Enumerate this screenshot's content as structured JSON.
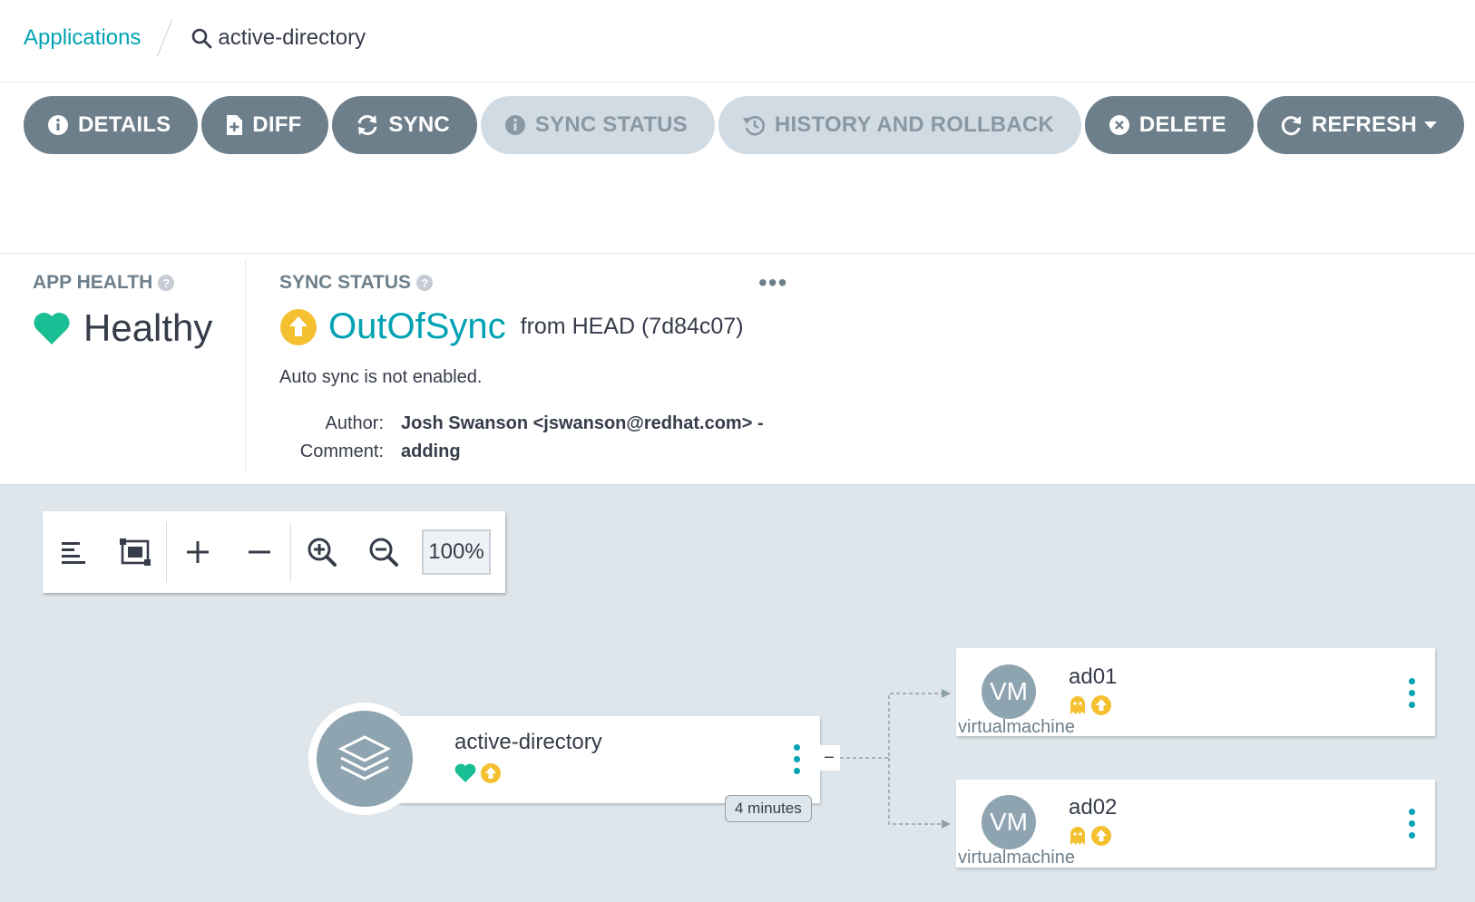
{
  "breadcrumb": {
    "root": "Applications",
    "current": "active-directory",
    "search_icon": "search-icon"
  },
  "toolbar": {
    "buttons": [
      {
        "label": "DETAILS",
        "icon": "info-icon"
      },
      {
        "label": "DIFF",
        "icon": "file-diff-icon"
      },
      {
        "label": "SYNC",
        "icon": "sync-icon"
      },
      {
        "label": "SYNC STATUS",
        "icon": "info-icon",
        "disabled": true
      },
      {
        "label": "HISTORY AND ROLLBACK",
        "icon": "history-icon",
        "disabled": true
      },
      {
        "label": "DELETE",
        "icon": "close-circle-icon"
      },
      {
        "label": "REFRESH",
        "icon": "refresh-icon",
        "dropdown": true
      }
    ]
  },
  "status": {
    "app_health_label": "APP HEALTH",
    "app_health_value": "Healthy",
    "sync_status_label": "SYNC STATUS",
    "sync_value": "OutOfSync",
    "sync_from": "from HEAD (7d84c07)",
    "auto_sync_note": "Auto sync is not enabled.",
    "author_label": "Author:",
    "author_value": "Josh Swanson <jswanson@redhat.com> -",
    "comment_label": "Comment:",
    "comment_value": "adding",
    "more_menu": "•••"
  },
  "graph_tools": {
    "zoom": "100%",
    "tools": [
      "align-left-icon",
      "fit-screen-icon",
      "plus-icon",
      "minus-icon",
      "zoom-in-icon",
      "zoom-out-icon"
    ]
  },
  "graph": {
    "app_node": {
      "name": "active-directory",
      "age": "4 minutes",
      "collapse": "−"
    },
    "children": [
      {
        "name": "ad01",
        "kind": "virtualmachine",
        "badge": "VM"
      },
      {
        "name": "ad02",
        "kind": "virtualmachine",
        "badge": "VM"
      }
    ]
  },
  "colors": {
    "accent": "#00a2b3",
    "healthy": "#18be94",
    "outofsync": "#f4c030",
    "button": "#6d7f8b",
    "button_disabled": "#d1dbe3",
    "graph_bg": "#dee6ec"
  }
}
